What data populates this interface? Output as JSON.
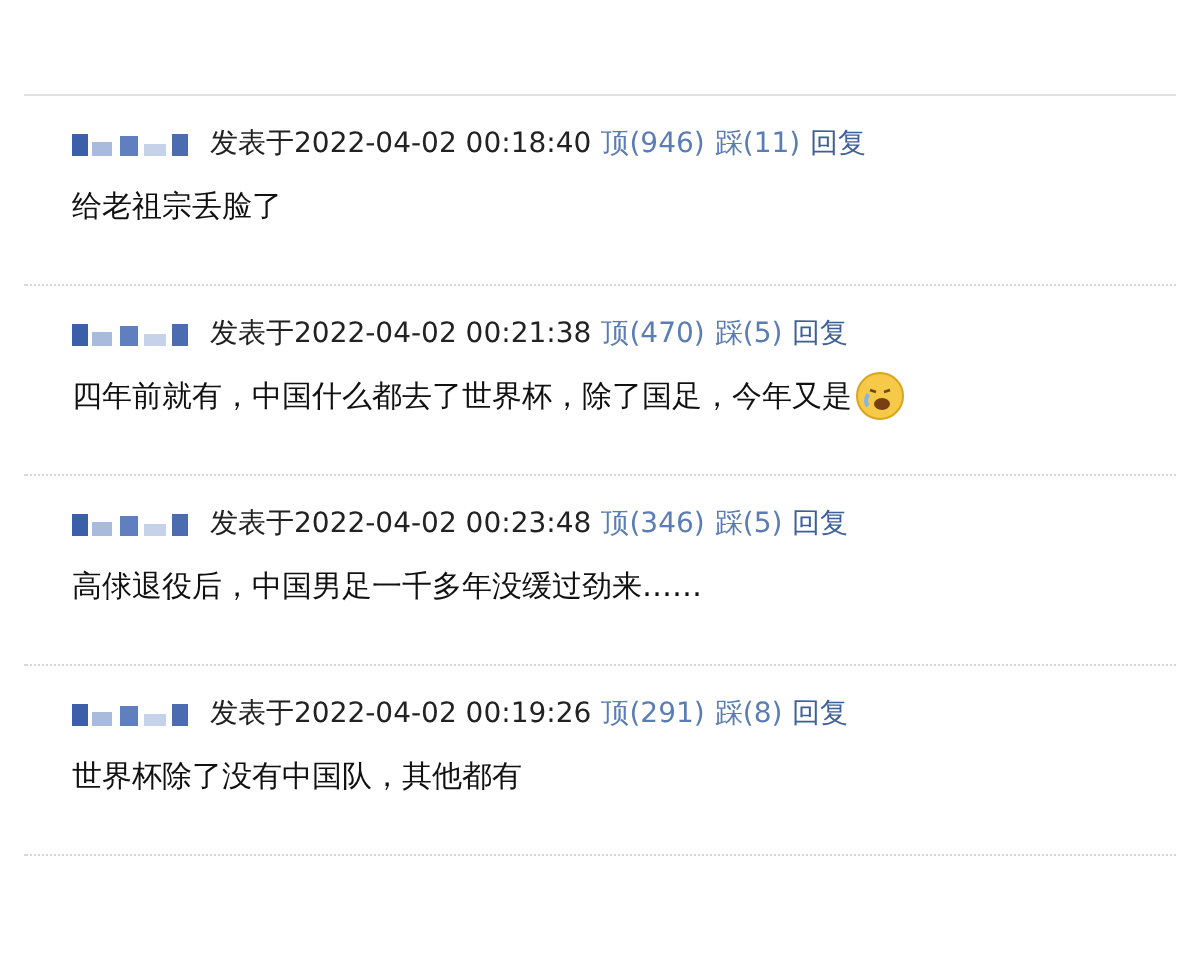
{
  "comments": [
    {
      "posted": "发表于2022-04-02 00:18:40",
      "up": "顶(946)",
      "down": "踩(11)",
      "reply": "回复",
      "text": "给老祖宗丢脸了",
      "emoji": false
    },
    {
      "posted": "发表于2022-04-02 00:21:38",
      "up": "顶(470)",
      "down": "踩(5)",
      "reply": "回复",
      "text": "四年前就有，中国什么都去了世界杯，除了国足，今年又是",
      "emoji": true
    },
    {
      "posted": "发表于2022-04-02 00:23:48",
      "up": "顶(346)",
      "down": "踩(5)",
      "reply": "回复",
      "text": "高俅退役后，中国男足一千多年没缓过劲来……",
      "emoji": false
    },
    {
      "posted": "发表于2022-04-02 00:19:26",
      "up": "顶(291)",
      "down": "踩(8)",
      "reply": "回复",
      "text": "世界杯除了没有中国队，其他都有",
      "emoji": false
    }
  ]
}
